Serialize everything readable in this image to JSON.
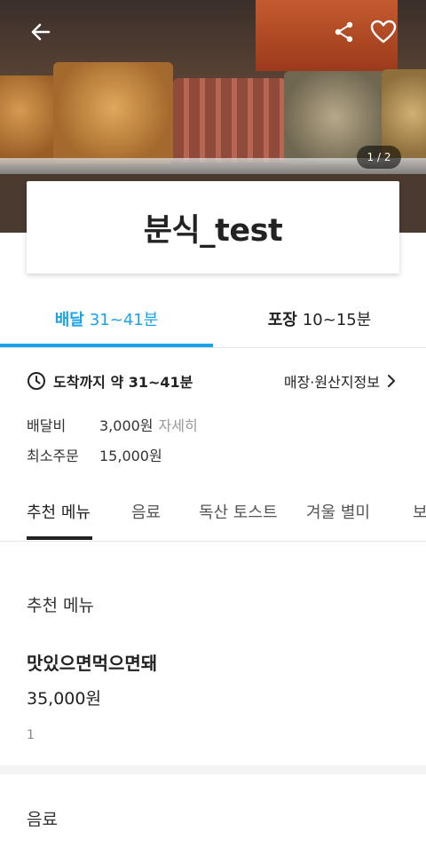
{
  "hero": {
    "pager": "1 / 2",
    "colors": {
      "overlay": "#000000"
    }
  },
  "icons": {
    "back": "arrow-left-icon",
    "share": "share-icon",
    "favorite": "heart-icon",
    "clock": "clock-icon",
    "chevron": "chevron-right-icon"
  },
  "store": {
    "title": "분식_test"
  },
  "order_tabs": [
    {
      "label": "배달",
      "time": "31~41분",
      "active": true
    },
    {
      "label": "포장",
      "time": "10~15분",
      "active": false
    }
  ],
  "info": {
    "arrival_text": "도착까지 약 31~41분",
    "origin_link": "매장·원산지정보",
    "delivery_fee_label": "배달비",
    "delivery_fee_value": "3,000원",
    "delivery_fee_detail": "자세히",
    "min_order_label": "최소주문",
    "min_order_value": "15,000원"
  },
  "category_tabs": [
    {
      "label": "추천 메뉴",
      "active": true
    },
    {
      "label": "음료",
      "active": false
    },
    {
      "label": "독산 토스트",
      "active": false
    },
    {
      "label": "겨울 별미",
      "active": false
    },
    {
      "label": "보",
      "active": false
    }
  ],
  "sections": [
    {
      "title": "추천 메뉴",
      "items": [
        {
          "name": "맛있으면먹으면돼",
          "price": "35,000원",
          "desc": "1"
        }
      ]
    },
    {
      "title": "음료"
    }
  ],
  "colors": {
    "accent": "#1aa3e8",
    "text": "#222222",
    "muted": "#999999"
  }
}
